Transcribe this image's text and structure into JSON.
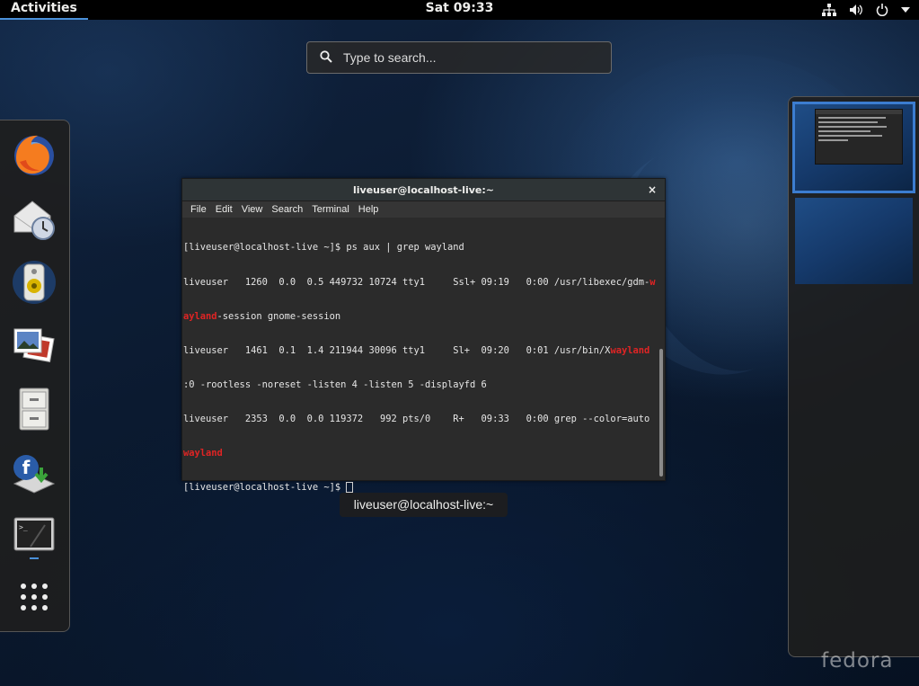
{
  "topbar": {
    "activities": "Activities",
    "clock": "Sat 09:33",
    "tray_icons": [
      "network-icon",
      "volume-icon",
      "power-icon",
      "chevron-down-icon"
    ]
  },
  "search": {
    "placeholder": "Type to search..."
  },
  "dash": {
    "apps": [
      "firefox",
      "evolution",
      "rhythmbox",
      "shotwell",
      "files",
      "fedora-installer",
      "terminal"
    ],
    "show_apps": "show-applications"
  },
  "terminal": {
    "title": "liveuser@localhost-live:~",
    "close": "×",
    "menu": [
      "File",
      "Edit",
      "View",
      "Search",
      "Terminal",
      "Help"
    ],
    "lines": [
      "[liveuser@localhost-live ~]$ ps aux | grep wayland",
      "liveuser   1260  0.0  0.5 449732 10724 tty1     Ssl+ 09:19   0:00 /usr/libexec/gdm-",
      "-session gnome-session",
      "liveuser   1461  0.1  1.4 211944 30096 tty1     Sl+  09:20   0:01 /usr/bin/X",
      ":0 -rootless -noreset -listen 4 -listen 5 -displayfd 6",
      "liveuser   2353  0.0  0.0 119372   992 pts/0    R+   09:33   0:00 grep --color=auto",
      "[liveuser@localhost-live ~]$ "
    ],
    "highlights": {
      "w": "w",
      "ayland": "ayland",
      "wayland": "wayland"
    }
  },
  "window_caption": "liveuser@localhost-live:~",
  "wordmark": "fedora",
  "colors": {
    "accent": "#4a90d9",
    "highlight": "#e02424"
  }
}
